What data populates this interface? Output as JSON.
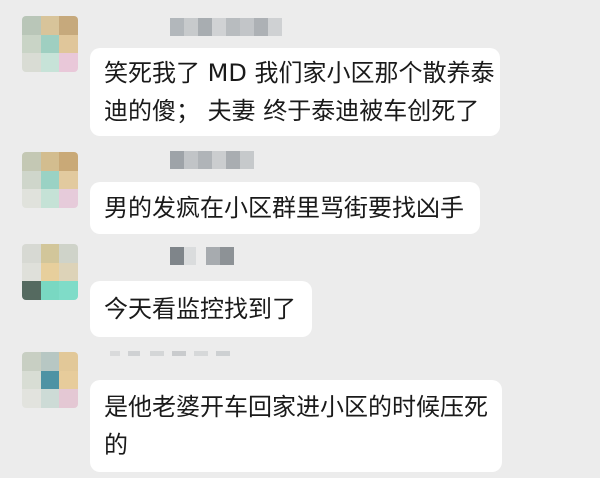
{
  "messages": [
    {
      "sender_name": "",
      "lines": [
        "笑死我了 MD 我们家小区那个散养泰",
        "迪的傻； 夫妻 终于泰迪被车创死了"
      ]
    },
    {
      "sender_name": "",
      "lines": [
        "男的发疯在小区群里骂街要找凶手"
      ]
    },
    {
      "sender_name": "",
      "lines": [
        "今天看监控找到了"
      ]
    },
    {
      "sender_name": "",
      "lines": [
        "是他老婆开车回家进小区的时候压死",
        "的"
      ]
    }
  ]
}
